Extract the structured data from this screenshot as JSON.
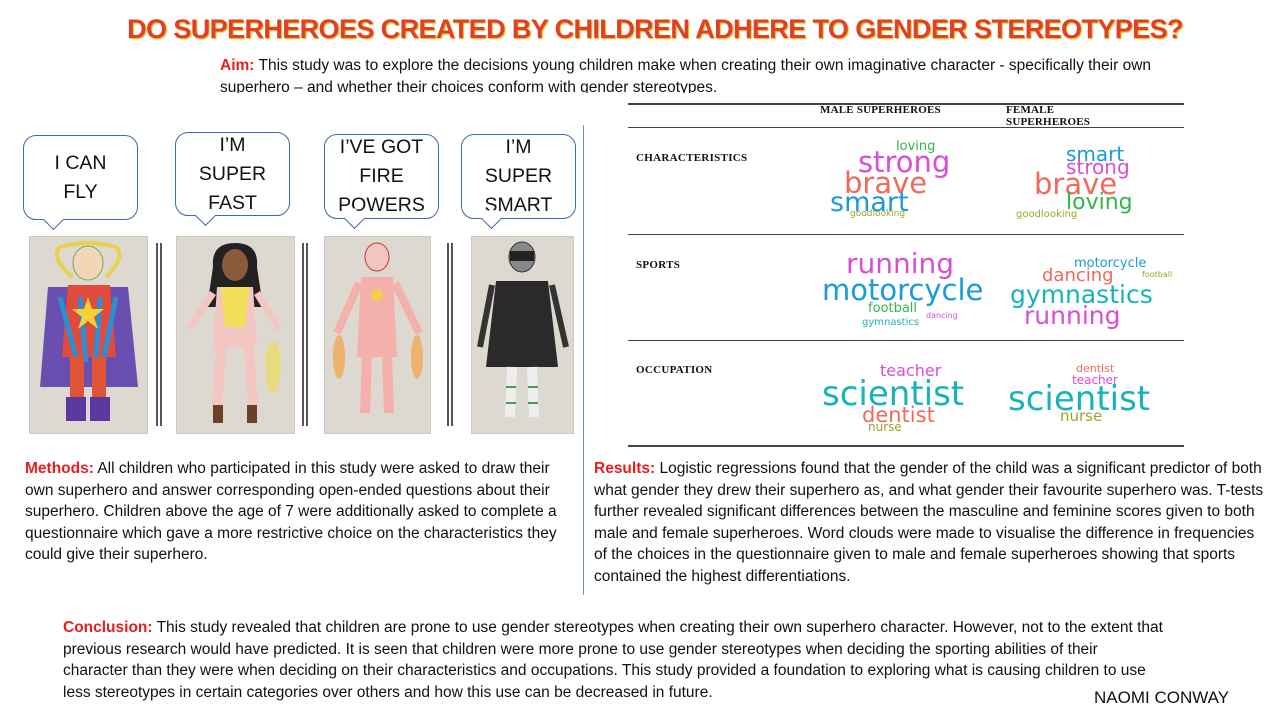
{
  "title": "DO SUPERHEROES CREATED BY CHILDREN ADHERE TO GENDER STEREOTYPES?",
  "aim": {
    "label": "Aim:",
    "text": " This study was to explore the decisions young children make when creating their own imaginative character - specifically their own superhero – and whether their choices conform with gender stereotypes."
  },
  "bubbles": [
    {
      "lines": [
        "I CAN",
        "FLY"
      ]
    },
    {
      "lines": [
        "I’M",
        "SUPER",
        "FAST"
      ]
    },
    {
      "lines": [
        "I’VE GOT",
        "FIRE",
        "POWERS"
      ]
    },
    {
      "lines": [
        "I’M",
        "SUPER",
        "SMART"
      ]
    }
  ],
  "table": {
    "col_headers": [
      "MALE SUPERHEROES",
      "FEMALE",
      "SUPERHEROES"
    ],
    "rows": [
      "CHARACTERISTICS",
      "SPORTS",
      "OCCUPATION"
    ],
    "clouds": {
      "characteristics_male": [
        "loving",
        "strong",
        "brave",
        "smart",
        "goodlooking"
      ],
      "characteristics_female": [
        "smart",
        "strong",
        "brave",
        "loving",
        "goodlooking"
      ],
      "sports_male": [
        "running",
        "motorcycle",
        "football",
        "dancing",
        "gymnastics"
      ],
      "sports_female": [
        "motorcycle",
        "dancing",
        "football",
        "gymnastics",
        "running"
      ],
      "occupation_male": [
        "teacher",
        "scientist",
        "dentist",
        "nurse"
      ],
      "occupation_female": [
        "dentist",
        "teacher",
        "scientist",
        "nurse"
      ]
    },
    "colors": {
      "blue": "#1a9bd7",
      "pink": "#d84fd6",
      "coral": "#f06a5a",
      "teal": "#18b3b8",
      "green": "#36b34a",
      "olive": "#9aa52a",
      "lightblue": "#3aa6e0"
    }
  },
  "methods": {
    "label": "Methods:",
    "text": " All children who participated in this study were asked to draw their own superhero and answer corresponding open-ended questions about their superhero. Children above the age of 7 were additionally asked to complete a questionnaire which gave a more restrictive choice on the characteristics they could give their superhero."
  },
  "results": {
    "label": "Results:",
    "text": " Logistic regressions found that the gender of the child was a significant predictor of both what gender they drew their superhero as, and what gender their favourite superhero was. T-tests further revealed significant differences between the masculine and feminine scores given to both male and female superheroes. Word clouds were made to visualise the difference in frequencies of the choices in the questionnaire given to male and female superheroes showing that sports contained the highest differentiations."
  },
  "conclusion": {
    "label": "Conclusion:",
    "text": " This study revealed that children are prone to use gender stereotypes when creating their own superhero character. However, not to the extent that previous research would have predicted. It is seen that children were more prone to use gender stereotypes when deciding the sporting abilities of their character than they were when deciding on their characteristics and occupations. This study provided a foundation to exploring what is causing children to use less stereotypes in certain categories over others and how this use can be decreased in future."
  },
  "author": "NAOMI CONWAY"
}
